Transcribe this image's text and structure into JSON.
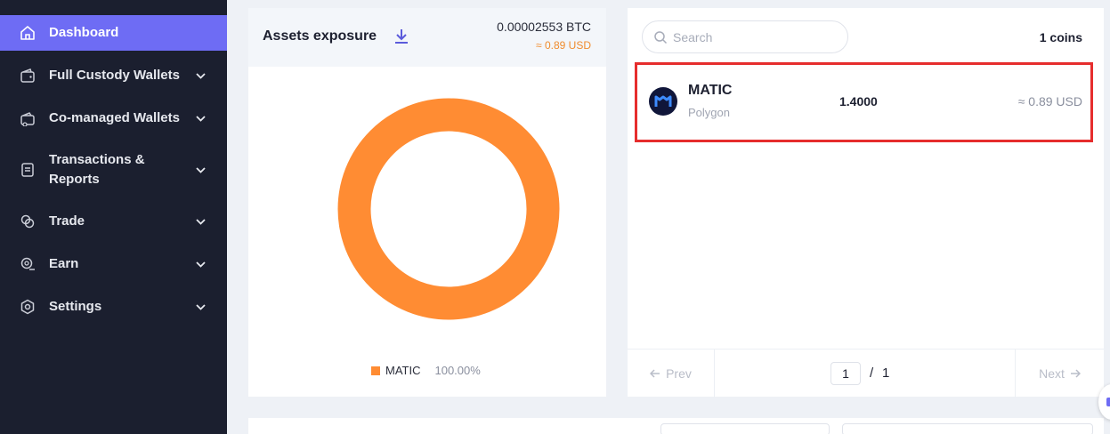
{
  "sidebar": {
    "items": [
      {
        "label": "Dashboard",
        "icon": "home-icon",
        "active": true
      },
      {
        "label": "Full Custody Wallets",
        "icon": "wallet-icon"
      },
      {
        "label": "Co-managed Wallets",
        "icon": "shared-wallet-icon"
      },
      {
        "label": "Transactions &",
        "label2": "Reports",
        "icon": "receipt-icon"
      },
      {
        "label": "Trade",
        "icon": "trade-icon"
      },
      {
        "label": "Earn",
        "icon": "earn-icon"
      },
      {
        "label": "Settings",
        "icon": "settings-icon"
      }
    ]
  },
  "assets": {
    "title": "Assets exposure",
    "btc_value": "0.00002553 BTC",
    "usd_value": "≈ 0.89 USD",
    "accent": "#f08c2e",
    "chart_data": {
      "type": "pie",
      "categories": [
        "MATIC"
      ],
      "values": [
        100.0
      ],
      "colors": [
        "#ff8c33"
      ],
      "legend": [
        {
          "name": "MATIC",
          "pct": "100.00%"
        }
      ]
    }
  },
  "coins": {
    "search_placeholder": "Search",
    "count_label": "1 coins",
    "list": [
      {
        "symbol": "MATIC",
        "network": "Polygon",
        "amount": "1.4000",
        "usd": "≈ 0.89 USD"
      }
    ],
    "pager": {
      "prev": "Prev",
      "next": "Next",
      "page": "1",
      "separator": "/",
      "total": "1"
    }
  },
  "colors": {
    "sidebar_bg": "#1b1f2f",
    "active": "#6e6cf4",
    "highlight": "#e62d2d"
  }
}
